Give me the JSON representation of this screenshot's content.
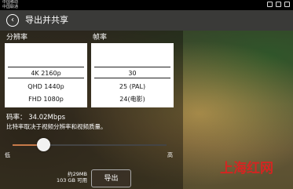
{
  "status_bar": {
    "carrier_1": "中国移动",
    "carrier_2": "中国联通"
  },
  "header": {
    "title": "导出并共享",
    "back_icon": "back-arrow-icon"
  },
  "resolution": {
    "label": "分辨率",
    "options": [
      "4K 2160p",
      "QHD 1440p",
      "FHD 1080p"
    ],
    "selected": "4K 2160p"
  },
  "framerate": {
    "label": "帧率",
    "options": [
      "30",
      "25 (PAL)",
      "24(电影)"
    ],
    "selected": "30"
  },
  "bitrate": {
    "text": "码率：  34.02Mbps",
    "note": "比特率取决于视频分辨率和视频质量。"
  },
  "quality_slider": {
    "low_label": "低",
    "high_label": "高",
    "level": 0.2
  },
  "file_info": {
    "size": "约29MB",
    "available": "103 GB 可用"
  },
  "export_button": {
    "label": "导出"
  },
  "watermark": "上海红网",
  "colors": {
    "accent": "#c77a4a",
    "titlebar": "#3a3a38",
    "watermark": "#e02020"
  }
}
